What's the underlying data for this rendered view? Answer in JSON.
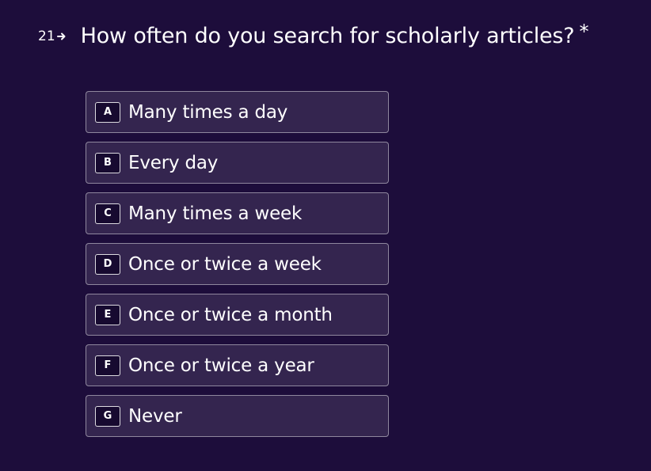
{
  "question": {
    "number": "21",
    "arrow_icon": "arrow-right-icon",
    "text": "How often do you search for scholarly articles?",
    "required_marker": "*"
  },
  "choices": [
    {
      "key": "A",
      "label": "Many times a day"
    },
    {
      "key": "B",
      "label": "Every day"
    },
    {
      "key": "C",
      "label": "Many times a week"
    },
    {
      "key": "D",
      "label": "Once or twice a week"
    },
    {
      "key": "E",
      "label": "Once or twice a month"
    },
    {
      "key": "F",
      "label": "Once or twice a year"
    },
    {
      "key": "G",
      "label": "Never"
    }
  ],
  "colors": {
    "background": "#1d0d3b",
    "text": "#ffffff"
  }
}
